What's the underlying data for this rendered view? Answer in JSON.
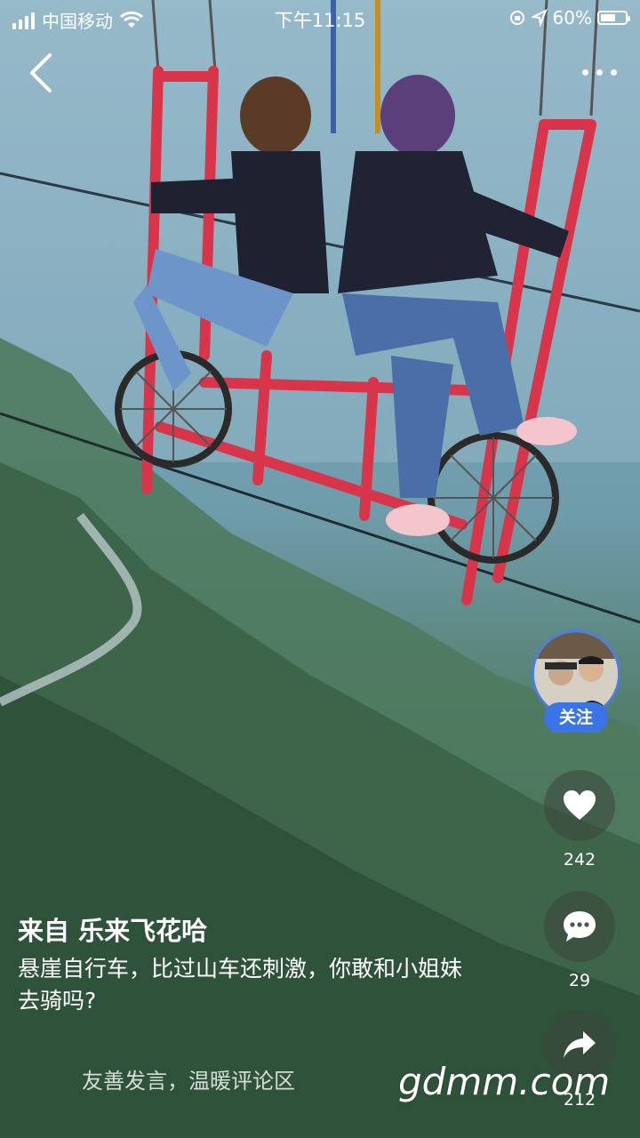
{
  "status_bar": {
    "carrier": "中国移动",
    "time": "下午11:15",
    "battery_percent": "60%",
    "battery_level": 0.6
  },
  "video": {
    "author_line": "来自 乐来飞花哈",
    "caption": "悬崖自行车，比过山车还刺激，你敢和小姐妹去骑吗?"
  },
  "profile": {
    "follow_label": "关注"
  },
  "actions": {
    "likes": "242",
    "comments": "29",
    "shares": "212"
  },
  "comment_input": {
    "placeholder": "友善发言，温暖评论区"
  },
  "watermark": "gdmm.com",
  "icons": {
    "back": "back-chevron-icon",
    "more": "more-dots-icon",
    "like": "heart-icon",
    "comment": "comment-bubble-icon",
    "share": "share-arrow-icon"
  }
}
